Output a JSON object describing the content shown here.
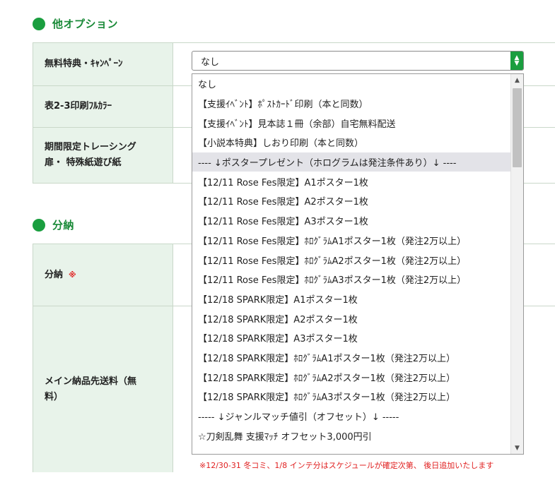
{
  "sections": {
    "other_options": {
      "title": "他オプション"
    },
    "installment": {
      "title": "分納"
    }
  },
  "rows": {
    "campaign": {
      "label": "無料特典・ｷｬﾝﾍﾟｰﾝ"
    },
    "fullcolor": {
      "label": "表2-3印刷ﾌﾙｶﾗｰ"
    },
    "tracing_line1": "期間限定トレーシング",
    "tracing_line2": "扉・ 特殊紙遊び紙",
    "installment": {
      "label": "分納",
      "required_mark": "※"
    },
    "main_shipping_line1": "メイン納品先送料（無",
    "main_shipping_line2": "料）"
  },
  "select": {
    "value": "なし"
  },
  "dropdown_options": [
    "なし",
    "【支援ｲﾍﾞﾝﾄ】ﾎﾟｽﾄｶｰﾄﾞ印刷（本と同数）",
    "【支援ｲﾍﾞﾝﾄ】見本誌１冊（余部）自宅無料配送",
    "【小説本特典】しおり印刷（本と同数）",
    "---- ↓ポスタープレゼント（ホログラムは発注条件あり）↓ ----",
    "【12/11 Rose Fes限定】A1ポスター1枚",
    "【12/11 Rose Fes限定】A2ポスター1枚",
    "【12/11 Rose Fes限定】A3ポスター1枚",
    "【12/11 Rose Fes限定】ﾎﾛｸﾞﾗﾑA1ポスター1枚（発注2万以上）",
    "【12/11 Rose Fes限定】ﾎﾛｸﾞﾗﾑA2ポスター1枚（発注2万以上）",
    "【12/11 Rose Fes限定】ﾎﾛｸﾞﾗﾑA3ポスター1枚（発注2万以上）",
    "【12/18 SPARK限定】A1ポスター1枚",
    "【12/18 SPARK限定】A2ポスター1枚",
    "【12/18 SPARK限定】A3ポスター1枚",
    "【12/18 SPARK限定】ﾎﾛｸﾞﾗﾑA1ポスター1枚（発注2万以上）",
    "【12/18 SPARK限定】ﾎﾛｸﾞﾗﾑA2ポスター1枚（発注2万以上）",
    "【12/18 SPARK限定】ﾎﾛｸﾞﾗﾑA3ポスター1枚（発注2万以上）",
    "----- ↓ジャンルマッチ値引（オフセット）↓ -----",
    "☆刀剣乱舞 支援ﾏｯﾁ オフセット3,000円引"
  ],
  "notice": "※12/30-31 冬コミ、1/8 インテ分はスケジュールが確定次第、 後日追加いたします",
  "colors": {
    "accent": "#1a9e3f",
    "label_bg": "#e8f3ea",
    "warning": "#e02020"
  }
}
